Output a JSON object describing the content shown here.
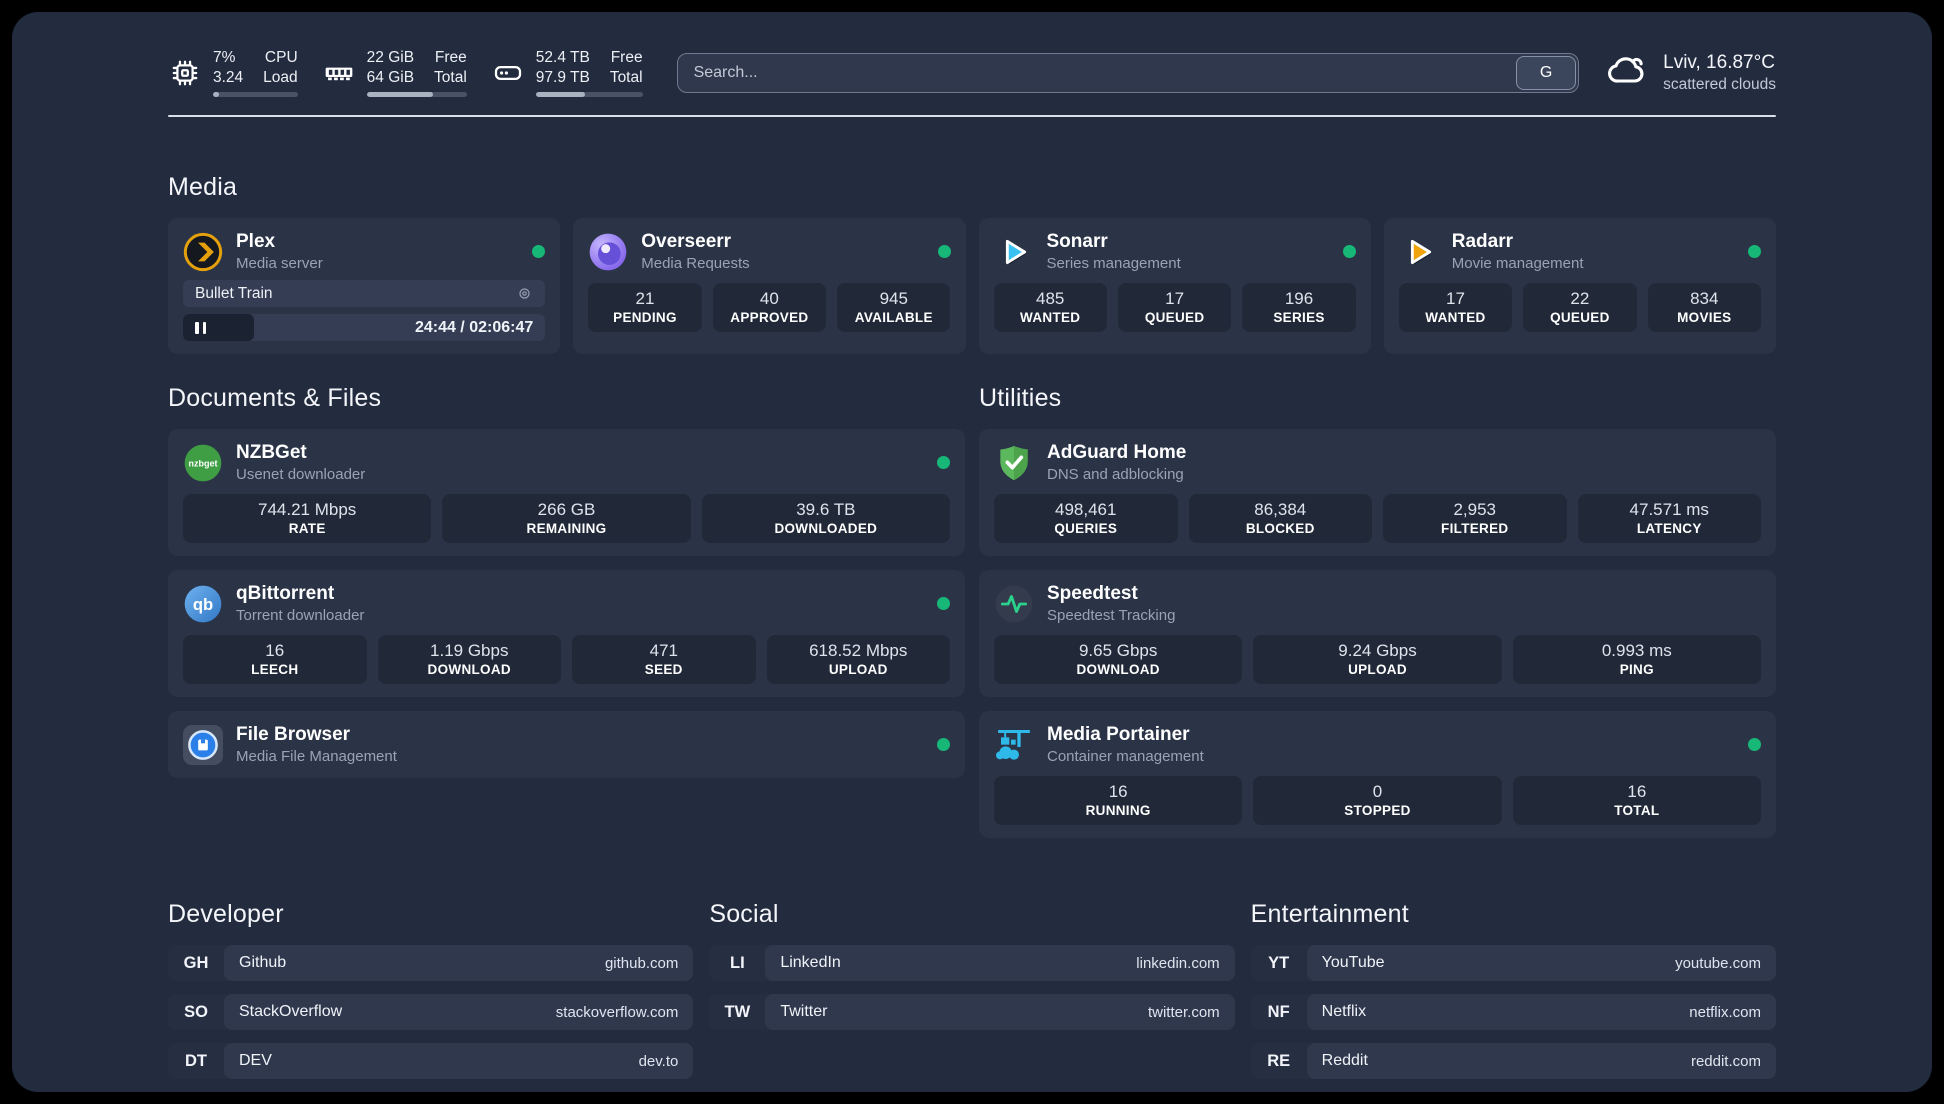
{
  "colors": {
    "page_bg": "#232b3e",
    "card_bg": "#2b3447",
    "stat_bg": "#212938",
    "status_online": "#17b877",
    "accent_plex": "#e5a00d",
    "accent_sonarr": "#38c1f1",
    "accent_radarr": "#f0a30a",
    "accent_portainer": "#2fb9e9"
  },
  "header": {
    "resources": [
      {
        "icon": "cpu-icon",
        "value_top": "7%",
        "value_bottom": "3.24",
        "label_top": "CPU",
        "label_bottom": "Load",
        "percent": 7
      },
      {
        "icon": "ram-icon",
        "value_top": "22 GiB",
        "value_bottom": "64 GiB",
        "label_top": "Free",
        "label_bottom": "Total",
        "percent": 66
      },
      {
        "icon": "disk-icon",
        "value_top": "52.4 TB",
        "value_bottom": "97.9 TB",
        "label_top": "Free",
        "label_bottom": "Total",
        "percent": 46
      }
    ],
    "search": {
      "placeholder": "Search...",
      "engine_button": "G"
    },
    "weather": {
      "summary": "Lviv, 16.87°C",
      "condition": "scattered clouds"
    }
  },
  "sections": {
    "media": {
      "title": "Media",
      "plex": {
        "name": "Plex",
        "description": "Media server",
        "status": "online",
        "now_playing": {
          "title": "Bullet Train",
          "time_display": "24:44 / 02:06:47",
          "elapsed": "24:44",
          "duration": "02:06:47",
          "progress_percent": 19.5,
          "state": "paused"
        }
      },
      "overseerr": {
        "name": "Overseerr",
        "description": "Media Requests",
        "status": "online",
        "stats": [
          {
            "value": "21",
            "label": "PENDING"
          },
          {
            "value": "40",
            "label": "APPROVED"
          },
          {
            "value": "945",
            "label": "AVAILABLE"
          }
        ]
      },
      "sonarr": {
        "name": "Sonarr",
        "description": "Series management",
        "status": "online",
        "stats": [
          {
            "value": "485",
            "label": "WANTED"
          },
          {
            "value": "17",
            "label": "QUEUED"
          },
          {
            "value": "196",
            "label": "SERIES"
          }
        ]
      },
      "radarr": {
        "name": "Radarr",
        "description": "Movie management",
        "status": "online",
        "stats": [
          {
            "value": "17",
            "label": "WANTED"
          },
          {
            "value": "22",
            "label": "QUEUED"
          },
          {
            "value": "834",
            "label": "MOVIES"
          }
        ]
      }
    },
    "documents": {
      "title": "Documents & Files",
      "nzbget": {
        "name": "NZBGet",
        "description": "Usenet downloader",
        "status": "online",
        "stats": [
          {
            "value": "744.21 Mbps",
            "label": "RATE"
          },
          {
            "value": "266 GB",
            "label": "REMAINING"
          },
          {
            "value": "39.6 TB",
            "label": "DOWNLOADED"
          }
        ]
      },
      "qbittorrent": {
        "name": "qBittorrent",
        "description": "Torrent downloader",
        "status": "online",
        "stats": [
          {
            "value": "16",
            "label": "LEECH"
          },
          {
            "value": "1.19 Gbps",
            "label": "DOWNLOAD"
          },
          {
            "value": "471",
            "label": "SEED"
          },
          {
            "value": "618.52 Mbps",
            "label": "UPLOAD"
          }
        ]
      },
      "filebrowser": {
        "name": "File Browser",
        "description": "Media File Management",
        "status": "online"
      }
    },
    "utilities": {
      "title": "Utilities",
      "adguard": {
        "name": "AdGuard Home",
        "description": "DNS and adblocking",
        "stats": [
          {
            "value": "498,461",
            "label": "QUERIES"
          },
          {
            "value": "86,384",
            "label": "BLOCKED"
          },
          {
            "value": "2,953",
            "label": "FILTERED"
          },
          {
            "value": "47.571 ms",
            "label": "LATENCY"
          }
        ]
      },
      "speedtest": {
        "name": "Speedtest",
        "description": "Speedtest Tracking",
        "stats": [
          {
            "value": "9.65 Gbps",
            "label": "DOWNLOAD"
          },
          {
            "value": "9.24 Gbps",
            "label": "UPLOAD"
          },
          {
            "value": "0.993 ms",
            "label": "PING"
          }
        ]
      },
      "portainer": {
        "name": "Media Portainer",
        "description": "Container management",
        "status": "online",
        "stats": [
          {
            "value": "16",
            "label": "RUNNING"
          },
          {
            "value": "0",
            "label": "STOPPED"
          },
          {
            "value": "16",
            "label": "TOTAL"
          }
        ]
      }
    }
  },
  "bookmarks": {
    "developer": {
      "title": "Developer",
      "items": [
        {
          "abbr": "GH",
          "name": "Github",
          "url": "github.com"
        },
        {
          "abbr": "SO",
          "name": "StackOverflow",
          "url": "stackoverflow.com"
        },
        {
          "abbr": "DT",
          "name": "DEV",
          "url": "dev.to"
        }
      ]
    },
    "social": {
      "title": "Social",
      "items": [
        {
          "abbr": "LI",
          "name": "LinkedIn",
          "url": "linkedin.com"
        },
        {
          "abbr": "TW",
          "name": "Twitter",
          "url": "twitter.com"
        }
      ]
    },
    "entertainment": {
      "title": "Entertainment",
      "items": [
        {
          "abbr": "YT",
          "name": "YouTube",
          "url": "youtube.com"
        },
        {
          "abbr": "NF",
          "name": "Netflix",
          "url": "netflix.com"
        },
        {
          "abbr": "RE",
          "name": "Reddit",
          "url": "reddit.com"
        }
      ]
    }
  }
}
